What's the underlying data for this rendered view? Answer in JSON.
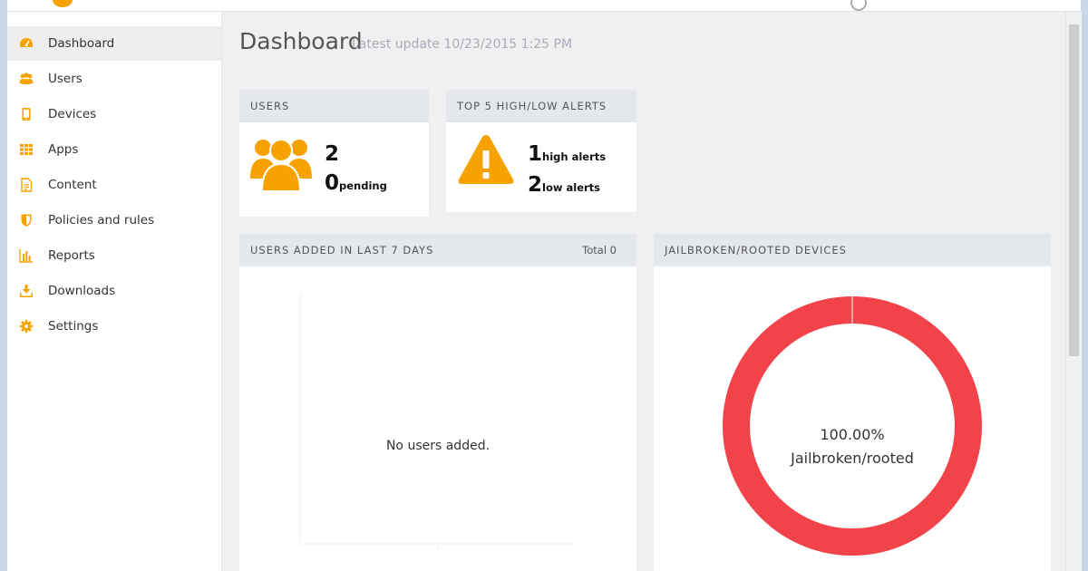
{
  "sidebar": {
    "items": [
      {
        "label": "Dashboard",
        "icon": "dashboard-icon"
      },
      {
        "label": "Users",
        "icon": "users-icon"
      },
      {
        "label": "Devices",
        "icon": "device-icon"
      },
      {
        "label": "Apps",
        "icon": "apps-grid-icon"
      },
      {
        "label": "Content",
        "icon": "document-icon"
      },
      {
        "label": "Policies and rules",
        "icon": "shield-icon"
      },
      {
        "label": "Reports",
        "icon": "bar-chart-icon"
      },
      {
        "label": "Downloads",
        "icon": "download-icon"
      },
      {
        "label": "Settings",
        "icon": "gear-icon"
      }
    ],
    "active": "Dashboard"
  },
  "header": {
    "title": "Dashboard",
    "subtitle": "Latest update 10/23/2015 1:25 PM"
  },
  "cards": {
    "users": {
      "title": "USERS",
      "count": "2",
      "pending_count": "0",
      "pending_label": "pending"
    },
    "alerts": {
      "title": "TOP 5 HIGH/LOW ALERTS",
      "high_count": "1",
      "high_label": "high alerts",
      "low_count": "2",
      "low_label": "low alerts"
    },
    "users_added": {
      "title": "USERS ADDED IN LAST 7 DAYS",
      "total_label": "Total 0",
      "empty_text": "No users added."
    },
    "jailbroken": {
      "title": "JAILBROKEN/ROOTED DEVICES",
      "percent_text": "100.00%",
      "label": "Jailbroken/rooted"
    }
  },
  "chart_data": {
    "type": "pie",
    "categories": [
      "Jailbroken/rooted"
    ],
    "values": [
      100.0
    ]
  },
  "colors": {
    "accent": "#f7a200",
    "donut": "#f2434a",
    "card_header": "#e4e8ec"
  }
}
